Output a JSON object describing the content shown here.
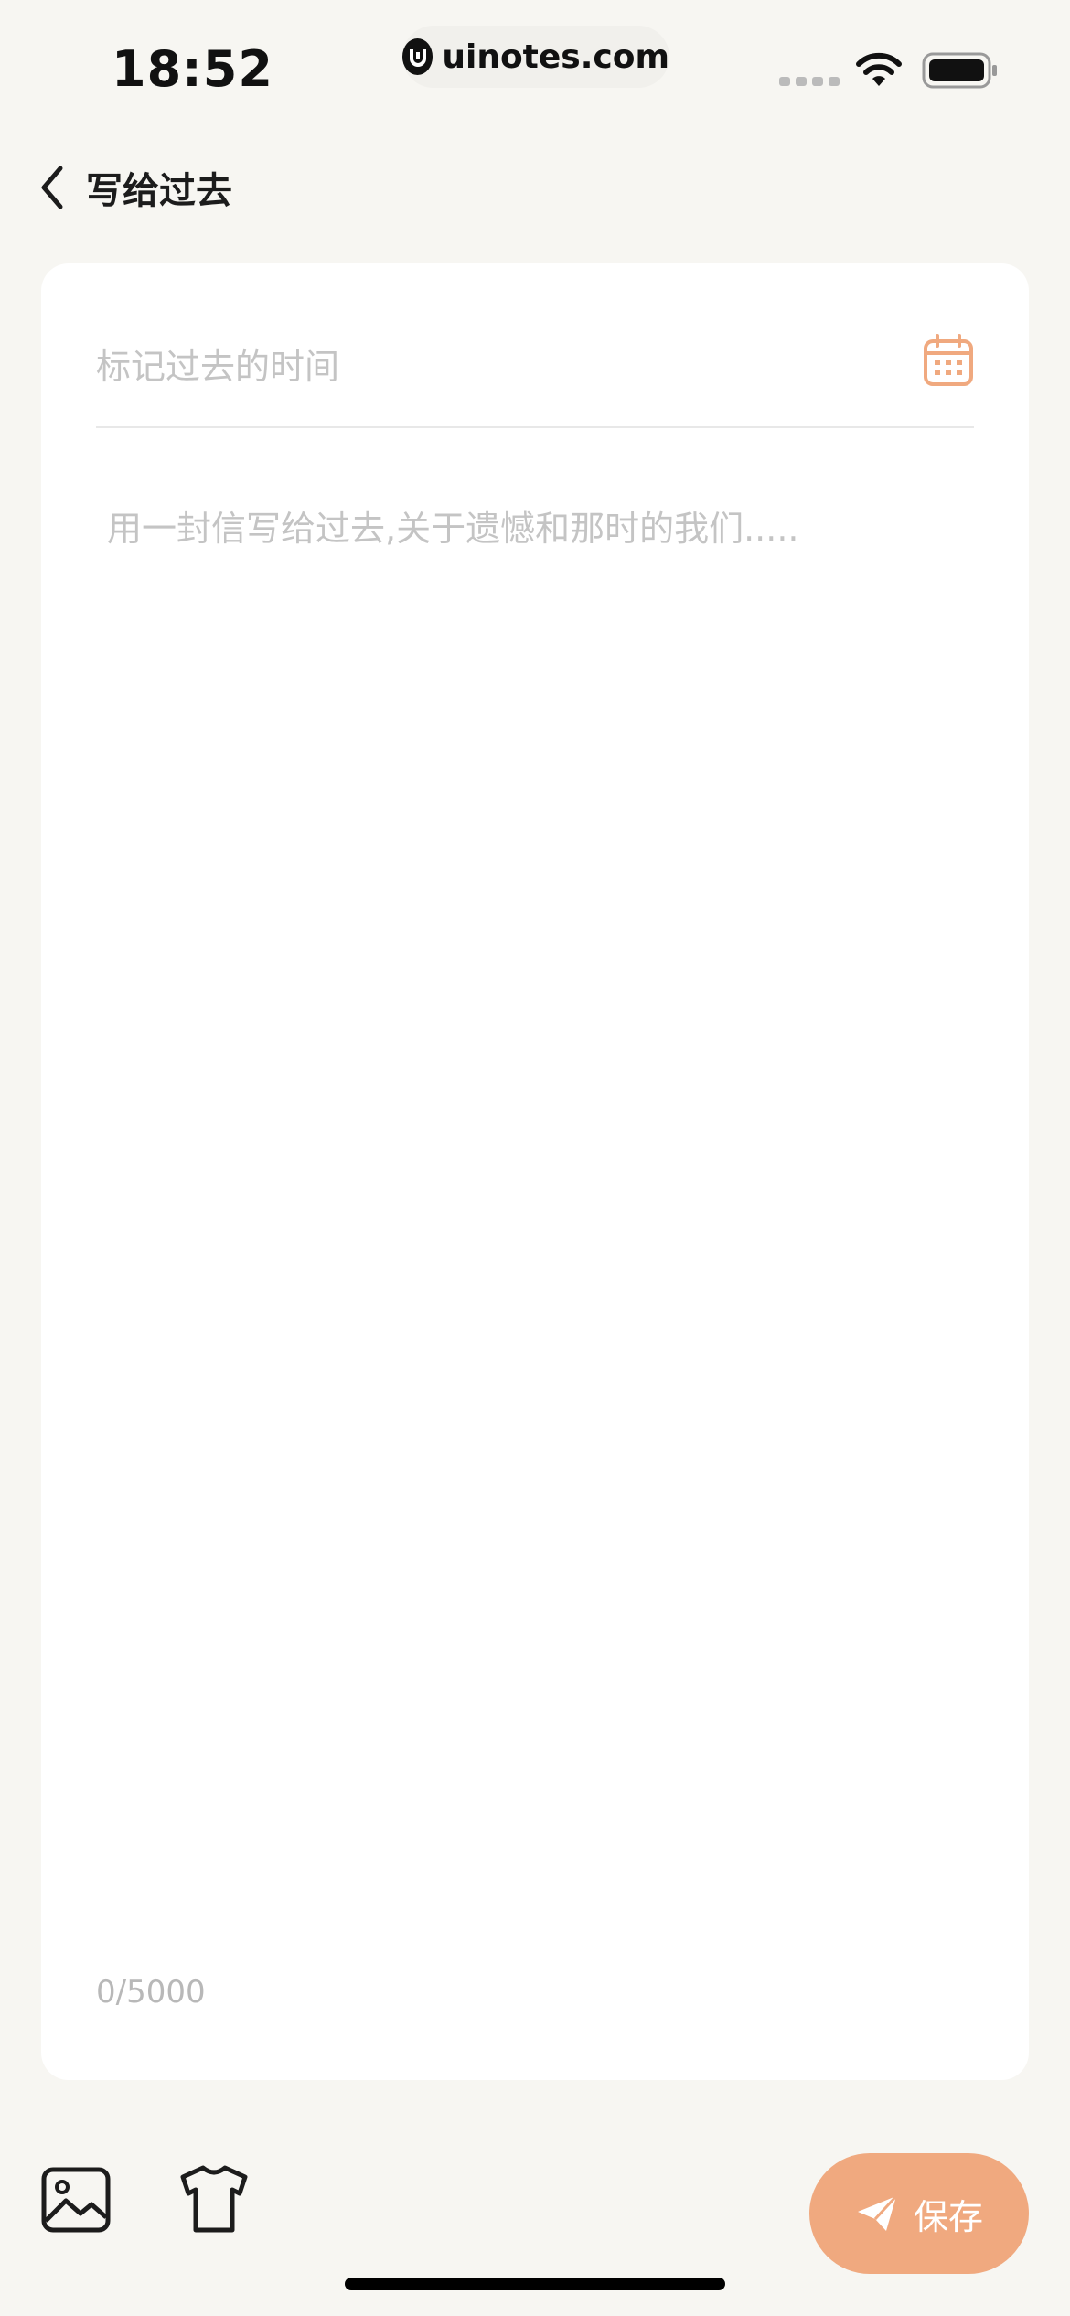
{
  "status_bar": {
    "time": "18:52",
    "url": "uinotes.com"
  },
  "nav": {
    "title": "写给过去"
  },
  "form": {
    "date_placeholder": "标记过去的时间",
    "letter_placeholder": "用一封信写给过去,关于遗憾和那时的我们.....",
    "counter": "0/5000"
  },
  "toolbar": {
    "save_label": "保存"
  },
  "colors": {
    "accent": "#f0a97f",
    "background": "#f7f6f2",
    "placeholder": "#c4c4c4"
  },
  "icons": [
    "back-chevron-icon",
    "calendar-icon",
    "image-icon",
    "shirt-icon",
    "send-icon",
    "wifi-icon",
    "battery-icon"
  ]
}
